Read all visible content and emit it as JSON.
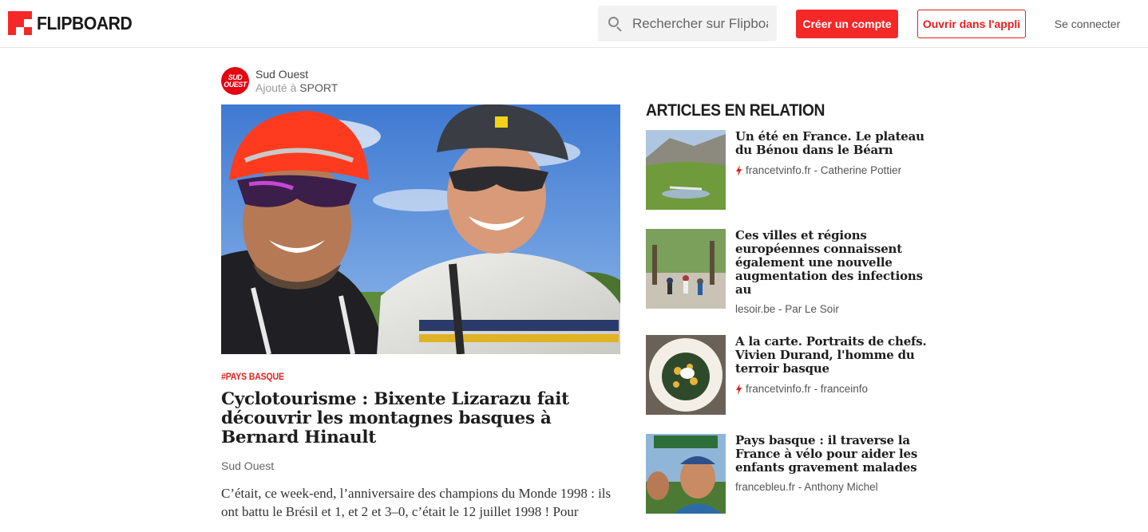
{
  "header": {
    "logo_text": "FLIPBOARD",
    "search_placeholder": "Rechercher sur Flipboard",
    "create_account": "Créer un compte",
    "open_in_app": "Ouvrir dans l'appli",
    "login": "Se connecter"
  },
  "colors": {
    "brand_red": "#f52828",
    "text_dark": "#1e1e1e",
    "text_muted": "#666666"
  },
  "article": {
    "source_name": "Sud Ouest",
    "source_logo_line1": "SUD",
    "source_logo_line2": "OUEST",
    "added_prefix": "Ajouté à ",
    "added_topic": "SPORT",
    "tag": "#PAYS BASQUE",
    "title": "Cyclotourisme : Bixente Lizarazu fait découvrir les montagnes basques à Bernard Hinault",
    "byline": "Sud Ouest",
    "excerpt": "C’était, ce week-end, l’anniversaire des champions du Monde 1998 : ils ont battu le Brésil et 1, et 2 et 3–0, c’était le 12 juillet 1998 ! Pour"
  },
  "related": {
    "heading": "ARTICLES EN RELATION",
    "items": [
      {
        "title": "Un été en France. Le plateau du Bénou dans le Béarn",
        "meta": "francetvinfo.fr - Catherine Pottier",
        "icon": "bolt-icon"
      },
      {
        "title": "Ces villes et régions européennes connaissent également une nouvelle augmentation des infections au",
        "meta": "lesoir.be - Par Le Soir",
        "icon": ""
      },
      {
        "title": "A la carte. Portraits de chefs. Vivien Durand, l'homme du terroir basque",
        "meta": "francetvinfo.fr - franceinfo",
        "icon": "bolt-icon"
      },
      {
        "title": "Pays basque : il traverse la France à vélo pour aider les enfants gravement malades",
        "meta": "francebleu.fr - Anthony Michel",
        "icon": ""
      }
    ]
  }
}
